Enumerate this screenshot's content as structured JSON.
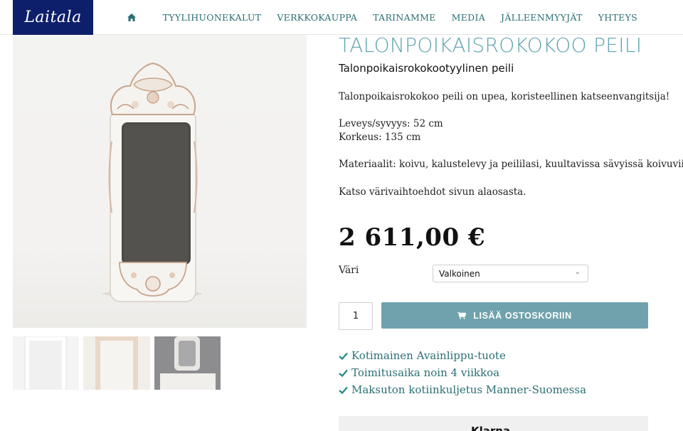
{
  "header": {
    "logo_text": "Laitala",
    "nav": [
      "TYYLIHUONEKALUT",
      "VERKKOKAUPPA",
      "TARINAMME",
      "MEDIA",
      "JÄLLEENMYYJÄT",
      "YHTEYS"
    ],
    "home_icon": "home-icon"
  },
  "product": {
    "title": "TALONPOIKAISROKOKOO PEILI",
    "subtitle": "Talonpoikaisrokokootyylinen peili",
    "description": [
      "Talonpoikaisrokokoo peili on upea, koristeellinen katseenvangitsija!",
      "Leveys/syvyys: 52 cm",
      "Korkeus: 135 cm",
      "Materiaalit: koivu, kalustelevy ja peililasi, kuultavissa sävyissä koivuviilu",
      "Katso värivaihtoehdot sivun alaosasta."
    ],
    "price": "2 611,00 €",
    "color_label": "Väri",
    "color_selected": "Valkoinen",
    "quantity": "1",
    "add_to_cart": "LISÄÄ OSTOSKORIIN",
    "usps": [
      "Kotimainen Avainlippu-tuote",
      "Toimitusaika noin 4 viikkoa",
      "Maksuton kotiinkuljetus Manner-Suomessa"
    ],
    "klarna_text": "Klarna."
  },
  "colors": {
    "logo_bg": "#0d1f6b",
    "nav_text": "#2b6f74",
    "title": "#5fa3b0",
    "button": "#6fa2ad",
    "usp": "#2b6f74"
  }
}
